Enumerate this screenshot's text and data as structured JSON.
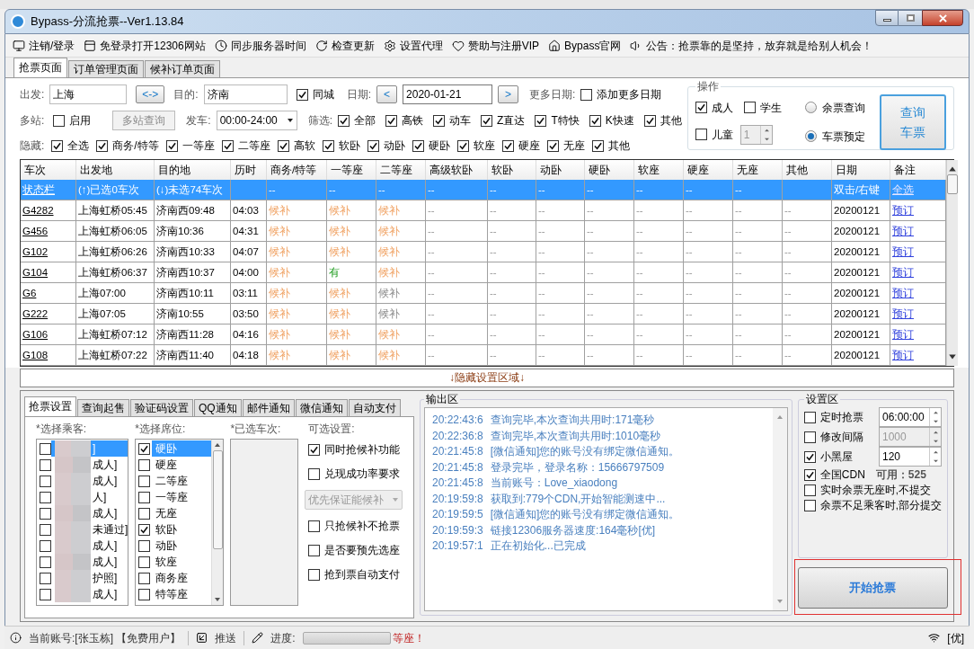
{
  "window": {
    "title": "Bypass-分流抢票--Ver1.13.84"
  },
  "toolbar": [
    {
      "label": "注销/登录"
    },
    {
      "label": "免登录打开12306网站"
    },
    {
      "label": "同步服务器时间"
    },
    {
      "label": "检查更新"
    },
    {
      "label": "设置代理"
    },
    {
      "label": "赞助与注册VIP"
    },
    {
      "label": "Bypass官网"
    },
    {
      "label": "公告：抢票靠的是坚持，放弃就是给别人机会！"
    }
  ],
  "tabs": [
    {
      "label": "抢票页面",
      "selected": true
    },
    {
      "label": "订单管理页面",
      "selected": false
    },
    {
      "label": "候补订单页面",
      "selected": false
    }
  ],
  "route": {
    "from_label": "出发:",
    "from": "上海",
    "swap": "<->",
    "to_label": "目的:",
    "to": "济南",
    "same_city": {
      "label": "同城",
      "checked": true
    },
    "date_label": "日期:",
    "prev": "<",
    "date": "2020-01-21",
    "next": ">",
    "more_dates_label": "更多日期:",
    "add_more_dates": {
      "label": "添加更多日期",
      "checked": false
    }
  },
  "multi": {
    "label": "多站:",
    "enable": {
      "label": "启用",
      "checked": false
    },
    "query_button": {
      "label": "多站查询",
      "disabled": true
    },
    "depart_label": "发车:",
    "depart_time": "00:00-24:00",
    "filter_label": "筛选:",
    "filters": [
      {
        "label": "全部",
        "checked": true
      },
      {
        "label": "高铁",
        "checked": true
      },
      {
        "label": "动车",
        "checked": true
      },
      {
        "label": "Z直达",
        "checked": true
      },
      {
        "label": "T特快",
        "checked": true
      },
      {
        "label": "K快速",
        "checked": true
      },
      {
        "label": "其他",
        "checked": true
      }
    ]
  },
  "hide": {
    "label": "隐藏:",
    "options": [
      {
        "label": "全选",
        "checked": true
      },
      {
        "label": "商务/特等",
        "checked": true
      },
      {
        "label": "一等座",
        "checked": true
      },
      {
        "label": "二等座",
        "checked": true
      },
      {
        "label": "高软",
        "checked": true
      },
      {
        "label": "软卧",
        "checked": true
      },
      {
        "label": "动卧",
        "checked": true
      },
      {
        "label": "硬卧",
        "checked": true
      },
      {
        "label": "软座",
        "checked": true
      },
      {
        "label": "硬座",
        "checked": true
      },
      {
        "label": "无座",
        "checked": true
      },
      {
        "label": "其他",
        "checked": true
      }
    ]
  },
  "operation": {
    "title": "操作",
    "passenger_types": [
      {
        "label": "成人",
        "checked": true
      },
      {
        "label": "学生",
        "checked": false
      },
      {
        "label": "儿童",
        "checked": false
      }
    ],
    "child_count": "1",
    "modes": [
      {
        "label": "余票查询",
        "selected": false
      },
      {
        "label": "车票预定",
        "selected": true
      }
    ],
    "query_button": "查询车票"
  },
  "table": {
    "columns": [
      "车次",
      "出发地",
      "目的地",
      "历时",
      "商务/特等",
      "一等座",
      "二等座",
      "高级软卧",
      "软卧",
      "动卧",
      "硬卧",
      "软座",
      "硬座",
      "无座",
      "其他",
      "日期",
      "备注"
    ],
    "rows": [
      {
        "selected": true,
        "train": "状态栏",
        "from": "(↑)已选0车次",
        "to": "(↓)未选74车次",
        "seats": [
          {
            "text": "--",
            "kind": "none"
          },
          {
            "text": "--",
            "kind": "none"
          },
          {
            "text": "--",
            "kind": "none"
          },
          {
            "text": "--",
            "kind": "none"
          },
          {
            "text": "--",
            "kind": "none"
          },
          {
            "text": "--",
            "kind": "none"
          },
          {
            "text": "--",
            "kind": "none"
          },
          {
            "text": "--",
            "kind": "none"
          },
          {
            "text": "--",
            "kind": "none"
          },
          {
            "text": "--",
            "kind": "none"
          }
        ],
        "date": "双击/右键",
        "note": "全选"
      },
      {
        "selected": false,
        "train": "G4282",
        "from": "上海虹桥05:45",
        "to": "济南西09:48",
        "duration": "04:03",
        "seats": [
          {
            "text": "候补",
            "kind": "waitlist"
          },
          {
            "text": "候补",
            "kind": "waitlist"
          },
          {
            "text": "候补",
            "kind": "waitlist"
          },
          {
            "text": "--",
            "kind": "none"
          },
          {
            "text": "--",
            "kind": "none"
          },
          {
            "text": "--",
            "kind": "none"
          },
          {
            "text": "--",
            "kind": "none"
          },
          {
            "text": "--",
            "kind": "none"
          },
          {
            "text": "--",
            "kind": "none"
          },
          {
            "text": "--",
            "kind": "none"
          },
          {
            "text": "--",
            "kind": "none"
          }
        ],
        "date": "20200121",
        "note": "预订"
      },
      {
        "selected": false,
        "train": "G456",
        "from": "上海虹桥06:05",
        "to": "济南10:36",
        "duration": "04:31",
        "seats": [
          {
            "text": "候补",
            "kind": "waitlist"
          },
          {
            "text": "候补",
            "kind": "waitlist"
          },
          {
            "text": "候补",
            "kind": "waitlist"
          },
          {
            "text": "--",
            "kind": "none"
          },
          {
            "text": "--",
            "kind": "none"
          },
          {
            "text": "--",
            "kind": "none"
          },
          {
            "text": "--",
            "kind": "none"
          },
          {
            "text": "--",
            "kind": "none"
          },
          {
            "text": "--",
            "kind": "none"
          },
          {
            "text": "--",
            "kind": "none"
          },
          {
            "text": "--",
            "kind": "none"
          }
        ],
        "date": "20200121",
        "note": "预订"
      },
      {
        "selected": false,
        "train": "G102",
        "from": "上海虹桥06:26",
        "to": "济南西10:33",
        "duration": "04:07",
        "seats": [
          {
            "text": "候补",
            "kind": "waitlist"
          },
          {
            "text": "候补",
            "kind": "waitlist"
          },
          {
            "text": "候补",
            "kind": "waitlist"
          },
          {
            "text": "--",
            "kind": "none"
          },
          {
            "text": "--",
            "kind": "none"
          },
          {
            "text": "--",
            "kind": "none"
          },
          {
            "text": "--",
            "kind": "none"
          },
          {
            "text": "--",
            "kind": "none"
          },
          {
            "text": "--",
            "kind": "none"
          },
          {
            "text": "--",
            "kind": "none"
          },
          {
            "text": "--",
            "kind": "none"
          }
        ],
        "date": "20200121",
        "note": "预订"
      },
      {
        "selected": false,
        "train": "G104",
        "from": "上海虹桥06:37",
        "to": "济南西10:37",
        "duration": "04:00",
        "seats": [
          {
            "text": "候补",
            "kind": "waitlist"
          },
          {
            "text": "有",
            "kind": "available"
          },
          {
            "text": "候补",
            "kind": "waitlist"
          },
          {
            "text": "--",
            "kind": "none"
          },
          {
            "text": "--",
            "kind": "none"
          },
          {
            "text": "--",
            "kind": "none"
          },
          {
            "text": "--",
            "kind": "none"
          },
          {
            "text": "--",
            "kind": "none"
          },
          {
            "text": "--",
            "kind": "none"
          },
          {
            "text": "--",
            "kind": "none"
          },
          {
            "text": "--",
            "kind": "none"
          }
        ],
        "date": "20200121",
        "note": "预订"
      },
      {
        "selected": false,
        "train": "G6",
        "from": "上海07:00",
        "to": "济南西10:11",
        "duration": "03:11",
        "seats": [
          {
            "text": "候补",
            "kind": "waitlist"
          },
          {
            "text": "候补",
            "kind": "waitlist"
          },
          {
            "text": "候补",
            "kind": "muted"
          },
          {
            "text": "--",
            "kind": "none"
          },
          {
            "text": "--",
            "kind": "none"
          },
          {
            "text": "--",
            "kind": "none"
          },
          {
            "text": "--",
            "kind": "none"
          },
          {
            "text": "--",
            "kind": "none"
          },
          {
            "text": "--",
            "kind": "none"
          },
          {
            "text": "--",
            "kind": "none"
          },
          {
            "text": "--",
            "kind": "none"
          }
        ],
        "date": "20200121",
        "note": "预订"
      },
      {
        "selected": false,
        "train": "G222",
        "from": "上海07:05",
        "to": "济南10:55",
        "duration": "03:50",
        "seats": [
          {
            "text": "候补",
            "kind": "waitlist"
          },
          {
            "text": "候补",
            "kind": "waitlist"
          },
          {
            "text": "候补",
            "kind": "muted"
          },
          {
            "text": "--",
            "kind": "none"
          },
          {
            "text": "--",
            "kind": "none"
          },
          {
            "text": "--",
            "kind": "none"
          },
          {
            "text": "--",
            "kind": "none"
          },
          {
            "text": "--",
            "kind": "none"
          },
          {
            "text": "--",
            "kind": "none"
          },
          {
            "text": "--",
            "kind": "none"
          },
          {
            "text": "--",
            "kind": "none"
          }
        ],
        "date": "20200121",
        "note": "预订"
      },
      {
        "selected": false,
        "train": "G106",
        "from": "上海虹桥07:12",
        "to": "济南西11:28",
        "duration": "04:16",
        "seats": [
          {
            "text": "候补",
            "kind": "waitlist"
          },
          {
            "text": "候补",
            "kind": "waitlist"
          },
          {
            "text": "候补",
            "kind": "waitlist"
          },
          {
            "text": "--",
            "kind": "none"
          },
          {
            "text": "--",
            "kind": "none"
          },
          {
            "text": "--",
            "kind": "none"
          },
          {
            "text": "--",
            "kind": "none"
          },
          {
            "text": "--",
            "kind": "none"
          },
          {
            "text": "--",
            "kind": "none"
          },
          {
            "text": "--",
            "kind": "none"
          },
          {
            "text": "--",
            "kind": "none"
          }
        ],
        "date": "20200121",
        "note": "预订"
      },
      {
        "selected": false,
        "train": "G108",
        "from": "上海虹桥07:22",
        "to": "济南西11:40",
        "duration": "04:18",
        "seats": [
          {
            "text": "候补",
            "kind": "waitlist"
          },
          {
            "text": "候补",
            "kind": "waitlist"
          },
          {
            "text": "候补",
            "kind": "waitlist"
          },
          {
            "text": "--",
            "kind": "none"
          },
          {
            "text": "--",
            "kind": "none"
          },
          {
            "text": "--",
            "kind": "none"
          },
          {
            "text": "--",
            "kind": "none"
          },
          {
            "text": "--",
            "kind": "none"
          },
          {
            "text": "--",
            "kind": "none"
          },
          {
            "text": "--",
            "kind": "none"
          },
          {
            "text": "--",
            "kind": "none"
          }
        ],
        "date": "20200121",
        "note": "预订"
      }
    ]
  },
  "hide_toggle": "↓隐藏设置区域↓",
  "settings_tabs": [
    {
      "label": "抢票设置",
      "selected": true
    },
    {
      "label": "查询起售",
      "selected": false
    },
    {
      "label": "验证码设置",
      "selected": false
    },
    {
      "label": "QQ通知",
      "selected": false
    },
    {
      "label": "邮件通知",
      "selected": false
    },
    {
      "label": "微信通知",
      "selected": false
    },
    {
      "label": "自动支付",
      "selected": false
    }
  ],
  "ticket_settings": {
    "passengers_label": "*选择乘客:",
    "passengers": [
      {
        "text": "]",
        "checked": false,
        "selected": true
      },
      {
        "text": "成人]",
        "checked": false,
        "selected": false
      },
      {
        "text": "成人]",
        "checked": false,
        "selected": false
      },
      {
        "text": "人]",
        "checked": false,
        "selected": false
      },
      {
        "text": "成人]",
        "checked": false,
        "selected": false
      },
      {
        "text": "未通过]",
        "checked": false,
        "selected": false
      },
      {
        "text": "成人]",
        "checked": false,
        "selected": false
      },
      {
        "text": "成人]",
        "checked": false,
        "selected": false
      },
      {
        "text": "护照]",
        "checked": false,
        "selected": false
      },
      {
        "text": "成人]",
        "checked": false,
        "selected": false
      }
    ],
    "seats_label": "*选择席位:",
    "seats": [
      {
        "label": "硬卧",
        "checked": true,
        "selected": true
      },
      {
        "label": "硬座",
        "checked": false,
        "selected": false
      },
      {
        "label": "二等座",
        "checked": false,
        "selected": false
      },
      {
        "label": "一等座",
        "checked": false,
        "selected": false
      },
      {
        "label": "无座",
        "checked": false,
        "selected": false
      },
      {
        "label": "软卧",
        "checked": true,
        "selected": false
      },
      {
        "label": "动卧",
        "checked": false,
        "selected": false
      },
      {
        "label": "软座",
        "checked": false,
        "selected": false
      },
      {
        "label": "商务座",
        "checked": false,
        "selected": false
      },
      {
        "label": "特等座",
        "checked": false,
        "selected": false
      }
    ],
    "trains_label": "*已选车次:",
    "options_label": "可选设置:",
    "options": [
      {
        "kind": "checkbox",
        "label": "同时抢候补功能",
        "checked": true
      },
      {
        "kind": "checkbox",
        "label": "兑现成功率要求",
        "checked": false
      },
      {
        "kind": "dropdown",
        "value": "优先保证能候补",
        "disabled": true
      },
      {
        "kind": "checkbox",
        "label": "只抢候补不抢票",
        "checked": false
      },
      {
        "kind": "checkbox",
        "label": "是否要预先选座",
        "checked": false
      },
      {
        "kind": "checkbox",
        "label": "抢到票自动支付",
        "checked": false
      }
    ]
  },
  "log": {
    "title": "输出区",
    "lines": [
      {
        "time": "20:22:43:6",
        "message": "查询完毕,本次查询共用时:171毫秒"
      },
      {
        "time": "20:22:36:8",
        "message": "查询完毕,本次查询共用时:1010毫秒"
      },
      {
        "time": "20:21:45:8",
        "message": "[微信通知]您的账号没有绑定微信通知。"
      },
      {
        "time": "20:21:45:8",
        "message": "登录完毕，登录名称：15666797509"
      },
      {
        "time": "20:21:45:8",
        "message": "当前账号：Love_xiaodong"
      },
      {
        "time": "20:19:59:8",
        "message": "获取到:779个CDN,开始智能测速中..."
      },
      {
        "time": "20:19:59:5",
        "message": "[微信通知]您的账号没有绑定微信通知。"
      },
      {
        "time": "20:19:59:3",
        "message": "链接12306服务器速度:164毫秒[优]"
      },
      {
        "time": "20:19:57:1",
        "message": "正在初始化...已完成"
      }
    ]
  },
  "config": {
    "title": "设置区",
    "items": [
      {
        "kind": "spinner",
        "label": "定时抢票",
        "checked": false,
        "value": "06:00:00",
        "disabled": false
      },
      {
        "kind": "spinner",
        "label": "修改间隔",
        "checked": false,
        "value": "1000",
        "disabled": true
      },
      {
        "kind": "spinner",
        "label": "小黑屋",
        "checked": true,
        "value": "120",
        "disabled": false
      },
      {
        "kind": "stat",
        "label": "全国CDN",
        "checked": true,
        "value": "可用：525"
      },
      {
        "kind": "plain",
        "label": "实时余票无座时,不提交",
        "checked": false
      },
      {
        "kind": "plain",
        "label": "余票不足乘客时,部分提交",
        "checked": false
      }
    ],
    "start_button": "开始抢票"
  },
  "status_bar": {
    "account": "当前账号:[张玉栋] 【免费用户】",
    "push": "推送",
    "progress_label": "进度:",
    "progress": {
      "level": 0
    },
    "message": "等座！",
    "quality": "[优]"
  }
}
